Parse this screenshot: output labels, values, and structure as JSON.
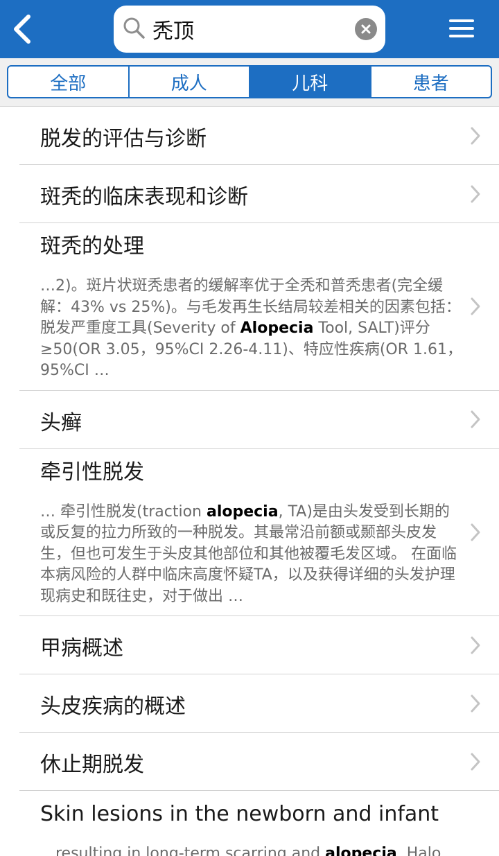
{
  "colors": {
    "brand": "#1d6ec2",
    "chevron": "#c4c4c4"
  },
  "header": {
    "back_icon": "chevron-left-icon",
    "search": {
      "value": "秃顶",
      "icon": "search-icon",
      "clear_icon": "clear-circle-icon"
    },
    "menu_icon": "hamburger-menu-icon"
  },
  "tabs": [
    {
      "label": "全部",
      "active": false
    },
    {
      "label": "成人",
      "active": false
    },
    {
      "label": "儿科",
      "active": true
    },
    {
      "label": "患者",
      "active": false
    }
  ],
  "results": [
    {
      "title": "脱发的评估与诊断"
    },
    {
      "title": "斑秃的临床表现和诊断"
    },
    {
      "title": "斑秃的处理",
      "snippet_pre": "…2)。斑片状斑秃患者的缓解率优于全秃和普秃患者(完全缓解：43% vs 25%)。与毛发再生长结局较差相关的因素包括：脱发严重度工具(Severity of ",
      "snippet_bold": "Alopecia",
      "snippet_post": " Tool, SALT)评分≥50(OR 3.05，95%CI 2.26-4.11)、特应性疾病(OR 1.61，95%CI …"
    },
    {
      "title": "头癣"
    },
    {
      "title": "牵引性脱发",
      "snippet_pre": "… 牵引性脱发(traction ",
      "snippet_bold": "alopecia",
      "snippet_post": ", TA)是由头发受到长期的或反复的拉力所致的一种脱发。其最常沿前额或颞部头皮发生，但也可发生于头皮其他部位和其他被覆毛发区域。 在面临本病风险的人群中临床高度怀疑TA，以及获得详细的头发护理现病史和既往史，对于做出 …"
    },
    {
      "title": "甲病概述"
    },
    {
      "title": "头皮疾病的概述"
    },
    {
      "title": "休止期脱发"
    },
    {
      "title": "Skin lesions in the newborn and infant",
      "snippet_pre": "…resulting in long-term scarring and ",
      "snippet_bold": "alopecia",
      "snippet_post": ". Halo scalp"
    }
  ]
}
